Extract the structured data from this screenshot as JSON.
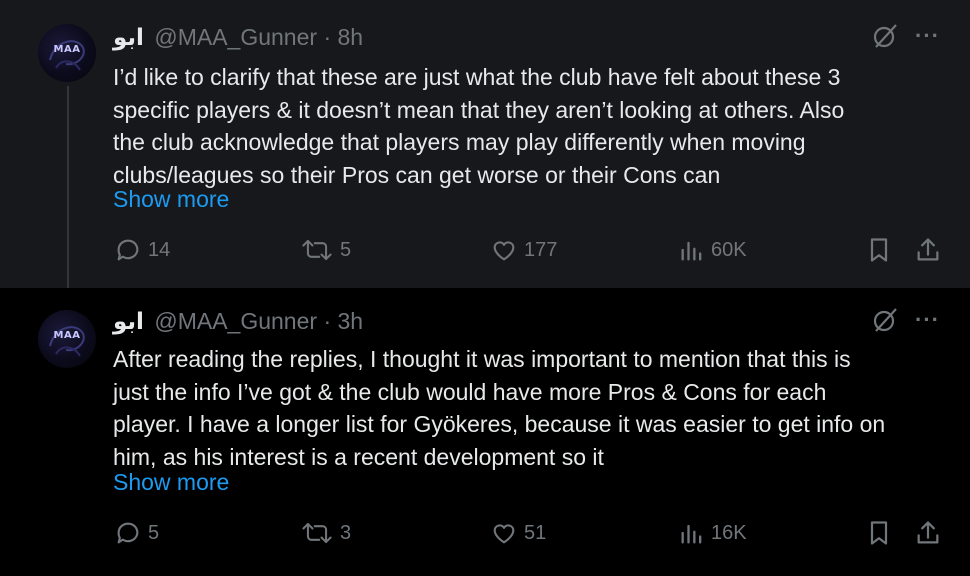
{
  "tweets": [
    {
      "display_name": "ابو",
      "handle": "@MAA_Gunner",
      "separator": "·",
      "time": "8h",
      "avatar_text": "MAA",
      "lines": [
        "I’d like to clarify that these are just what the club have felt about these 3",
        "specific players & it doesn’t mean that they aren’t looking at others. Also",
        "the club acknowledge that players may play differently when moving",
        "clubs/leagues so their Pros can get worse or their Cons can"
      ],
      "show_more": "Show more",
      "replies": "14",
      "retweets": "5",
      "likes": "177",
      "views": "60K",
      "more_glyph": "···"
    },
    {
      "display_name": "ابو",
      "handle": "@MAA_Gunner",
      "separator": "·",
      "time": "3h",
      "avatar_text": "MAA",
      "lines": [
        "After reading the replies, I thought it was important to mention that this is",
        "just the info I’ve got & the club would have more Pros & Cons for each",
        "player. I have a longer list for Gyökeres, because it was easier to get info on",
        "him, as his interest is a recent development so it"
      ],
      "show_more": "Show more",
      "replies": "5",
      "retweets": "3",
      "likes": "51",
      "views": "16K",
      "more_glyph": "···"
    }
  ],
  "icons": {
    "reply": "reply-icon",
    "retweet": "retweet-icon",
    "like": "like-icon",
    "views": "views-icon",
    "bookmark": "bookmark-icon",
    "share": "share-icon",
    "grok": "grok-icon",
    "more": "more-icon"
  },
  "colors": {
    "background": "#000000",
    "highlight_background": "#16181c",
    "text": "#e7e9ea",
    "muted": "#71767b",
    "link": "#1d9bf0",
    "thread_line": "#333639"
  }
}
